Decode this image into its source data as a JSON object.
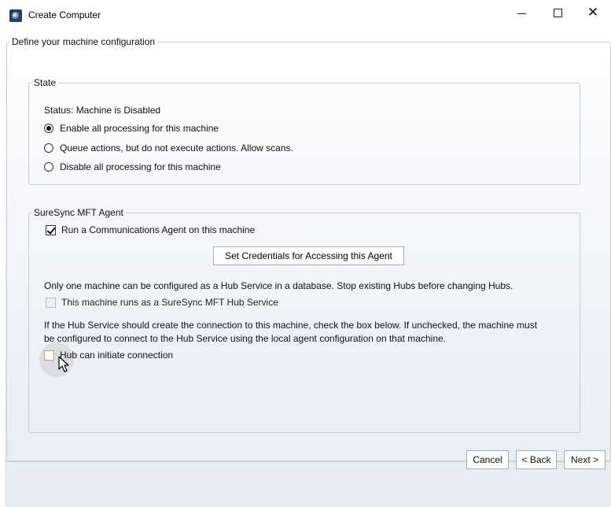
{
  "window": {
    "title": "Create Computer",
    "icon": "app-logo-icon"
  },
  "main": {
    "group_title": "Define your machine configuration"
  },
  "state": {
    "legend": "State",
    "status_text": "Status: Machine is Disabled",
    "options": [
      {
        "label": "Enable all processing for this machine",
        "selected": true
      },
      {
        "label": "Queue actions, but do not execute actions. Allow scans.",
        "selected": false
      },
      {
        "label": "Disable all processing for this machine",
        "selected": false
      }
    ]
  },
  "agent": {
    "legend": "SureSync MFT Agent",
    "run_agent_label": "Run a Communications Agent on this machine",
    "run_agent_checked": true,
    "credentials_button": "Set Credentials for Accessing this Agent",
    "hub_note": "Only one machine can be configured as a Hub Service in a database. Stop existing Hubs before changing Hubs.",
    "hub_service_label": "This machine runs as a SureSync MFT Hub Service",
    "hub_service_checked": false,
    "hub_connect_note_line1": "If the Hub Service should create the connection to this machine, check the box below. If unchecked, the machine must",
    "hub_connect_note_line2": "be configured to connect to the Hub Service using the local agent configuration on that machine.",
    "hub_initiate_label": "Hub can initiate connection",
    "hub_initiate_checked": false
  },
  "footer": {
    "cancel": "Cancel",
    "back": "< Back",
    "next": "Next >"
  }
}
